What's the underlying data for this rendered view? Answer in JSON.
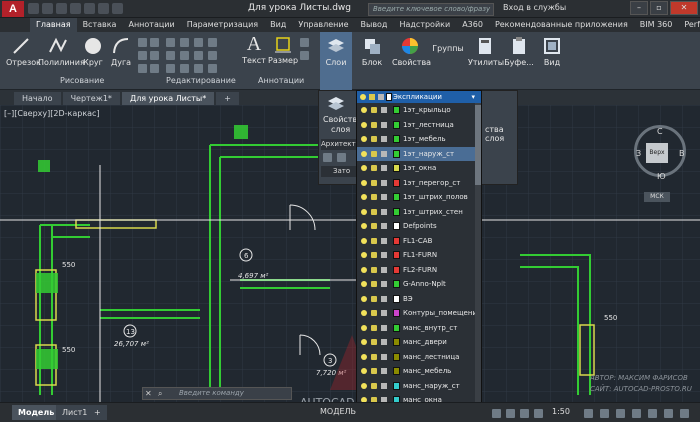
{
  "app": {
    "logo": "A",
    "document_title": "Для урока Листы.dwg",
    "search_placeholder": "Введите ключевое слово/фразу",
    "login": "Вход в службы",
    "window_buttons": [
      "–",
      "▫",
      "✕"
    ]
  },
  "ribbon_tabs": [
    "Главная",
    "Вставка",
    "Аннотации",
    "Параметризация",
    "Вид",
    "Управление",
    "Вывод",
    "Надстройки",
    "A360",
    "Рекомендованные приложения",
    "BIM 360",
    "Performance"
  ],
  "ribbon": {
    "draw": {
      "buttons": [
        "Отрезок",
        "Полилиния",
        "Круг",
        "Дуга"
      ],
      "panel": "Рисование"
    },
    "modify": {
      "panel": "Редактирование"
    },
    "annotation": {
      "buttons": [
        "Текст",
        "Размер"
      ],
      "panel": "Аннотации"
    },
    "tools": [
      "Слои",
      "Блок",
      "Свойства",
      "Группы",
      "Утилиты",
      "Буфе...",
      "Вид"
    ]
  },
  "file_tabs": [
    "Начало",
    "Чертеж1*",
    "Для урока Листы*",
    "+"
  ],
  "viewport_label": "[–][Сверху][2D-каркас]",
  "flyout": {
    "properties_label_1": "Свойства",
    "properties_label_2": "слоя",
    "architecture": "Архитекту",
    "right_label": "ства слоя",
    "zero": "Зато"
  },
  "layer_current": "Экспликации",
  "layers": [
    {
      "name": "1эт_крыльцо",
      "color": "#33cc33"
    },
    {
      "name": "1эт_лестница",
      "color": "#33cc33"
    },
    {
      "name": "1эт_мебель",
      "color": "#33cc33"
    },
    {
      "name": "1эт_наруж_ст",
      "color": "#33cc33"
    },
    {
      "name": "1эт_окна",
      "color": "#d9d94c"
    },
    {
      "name": "1эт_перегор_ст",
      "color": "#e53935"
    },
    {
      "name": "1эт_штрих_полов",
      "color": "#33cc33"
    },
    {
      "name": "1эт_штрих_стен",
      "color": "#33cc33"
    },
    {
      "name": "Defpoints",
      "color": "#ffffff"
    },
    {
      "name": "FL1-CAB",
      "color": "#e53935"
    },
    {
      "name": "FL1-FURN",
      "color": "#e53935"
    },
    {
      "name": "FL2-FURN",
      "color": "#e53935"
    },
    {
      "name": "G-Anno-Nplt",
      "color": "#33cc33"
    },
    {
      "name": "ВЭ",
      "color": "#ffffff"
    },
    {
      "name": "Контуры_помещений",
      "color": "#cc44cc"
    },
    {
      "name": "манс_внутр_ст",
      "color": "#33cc33"
    },
    {
      "name": "манс_двери",
      "color": "#8b8b00"
    },
    {
      "name": "манс_лестница",
      "color": "#8b8b00"
    },
    {
      "name": "манс_мебель",
      "color": "#8b8b00"
    },
    {
      "name": "манс_наруж_ст",
      "color": "#33cccc"
    },
    {
      "name": "манс_окна",
      "color": "#33cccc"
    },
    {
      "name": "манс_перегор_ст",
      "color": "#e53935"
    }
  ],
  "drawing": {
    "dims": [
      "550",
      "550",
      "550"
    ],
    "rooms": [
      {
        "num": "6",
        "area": "4,697 м²"
      },
      {
        "num": "13",
        "area": "26,707 м²"
      },
      {
        "num": "3",
        "area": "7,720 м²"
      }
    ]
  },
  "viewcube": {
    "n": "С",
    "s": "Ю",
    "w": "З",
    "e": "В",
    "top": "Верх",
    "wcs": "МСК"
  },
  "command_placeholder": "Введите команду",
  "status": {
    "tabs": [
      "Модель",
      "Лист1",
      "+"
    ],
    "model_label": "МОДЕЛЬ",
    "scale": "1:50"
  },
  "watermark": {
    "brand": "AUTOCAD",
    "author": "АВТОР: МАКСИМ ФАРИСОВ",
    "site": "САЙТ: AUTOCAD-PROSTO.RU"
  }
}
